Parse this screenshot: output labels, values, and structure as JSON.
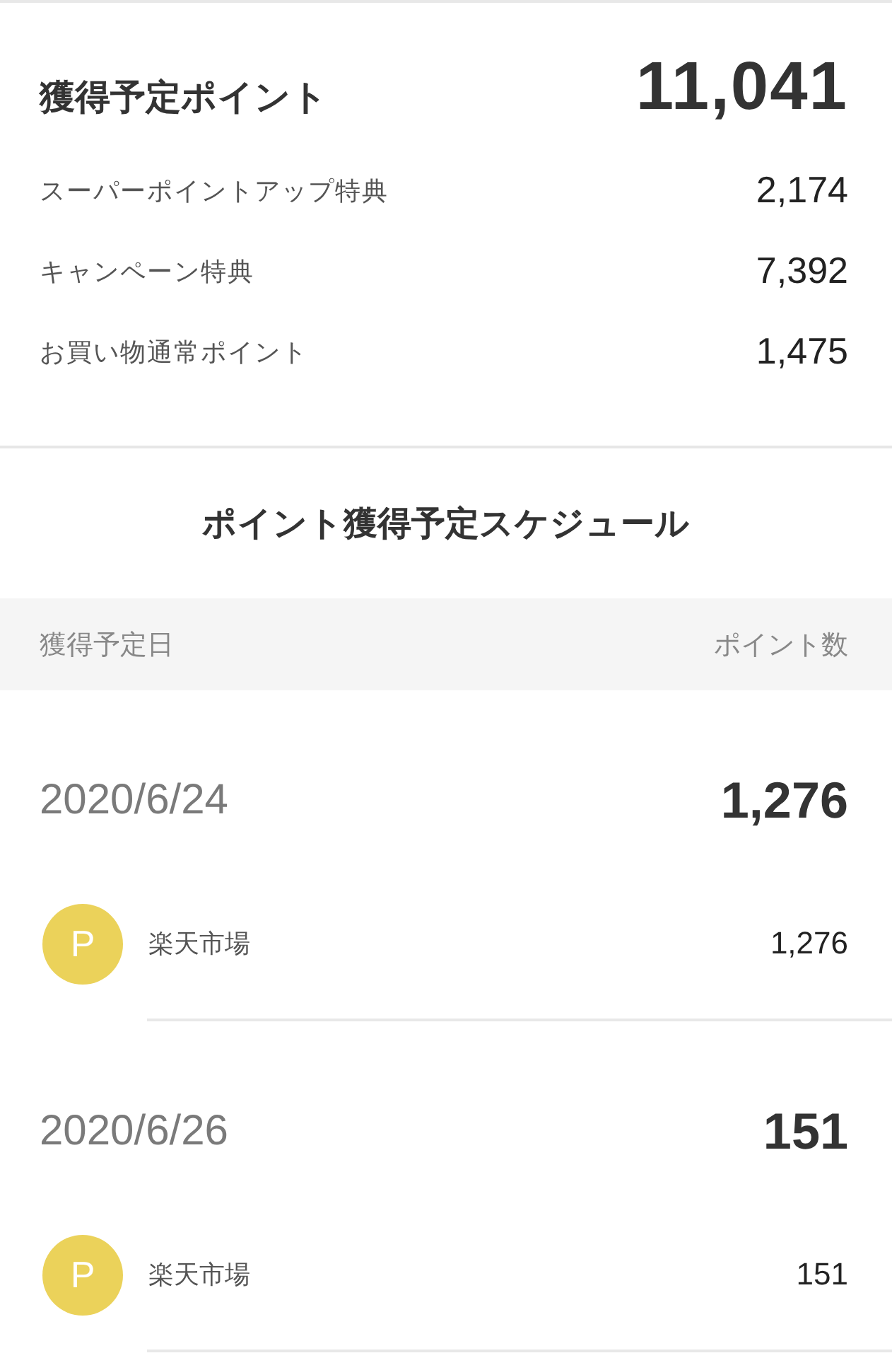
{
  "summary": {
    "title": "獲得予定ポイント",
    "total": "11,041",
    "breakdown": [
      {
        "label": "スーパーポイントアップ特典",
        "value": "2,174"
      },
      {
        "label": "キャンペーン特典",
        "value": "7,392"
      },
      {
        "label": "お買い物通常ポイント",
        "value": "1,475"
      }
    ]
  },
  "schedule": {
    "title": "ポイント獲得予定スケジュール",
    "columns": [
      "獲得予定日",
      "ポイント数"
    ],
    "entries": [
      {
        "date": "2020/6/24",
        "total": "1,276",
        "items": [
          {
            "badge": "P",
            "shop": "楽天市場",
            "points": "1,276"
          }
        ]
      },
      {
        "date": "2020/6/26",
        "total": "151",
        "items": [
          {
            "badge": "P",
            "shop": "楽天市場",
            "points": "151"
          }
        ]
      }
    ]
  }
}
